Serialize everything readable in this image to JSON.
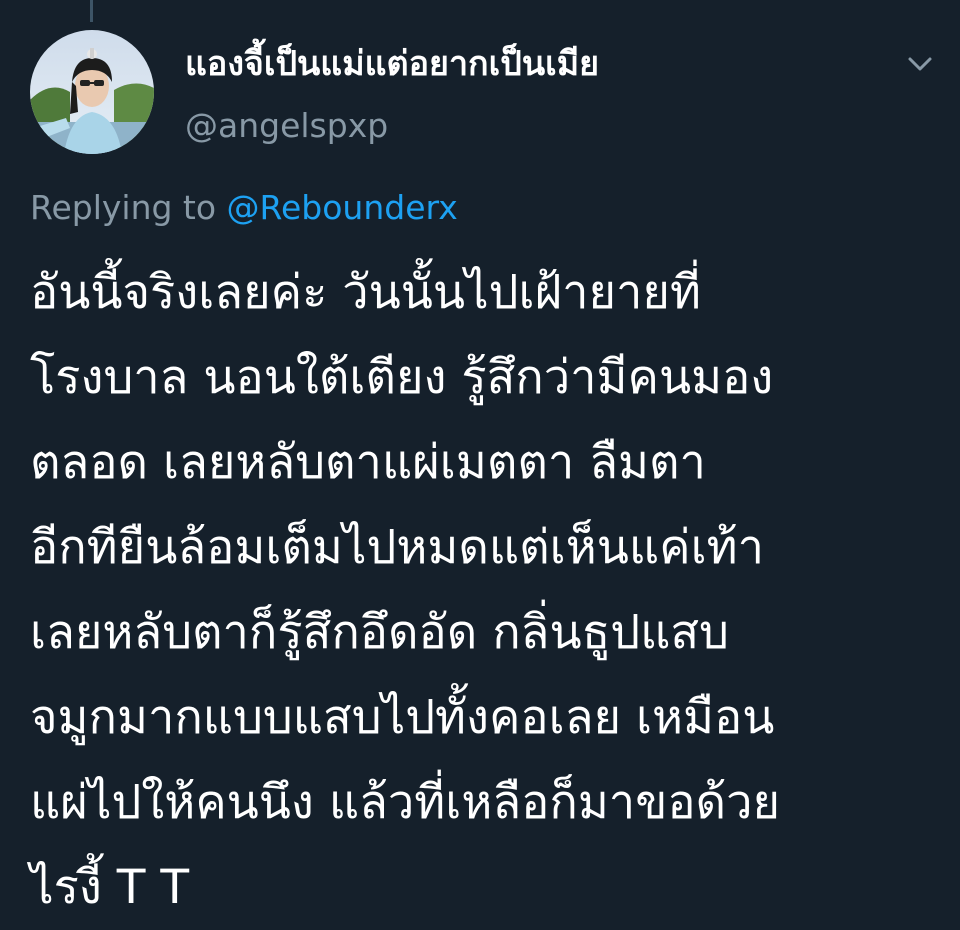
{
  "tweet": {
    "display_name": "แองจี้เป็นแม่แต่อยากเป็นเมีย",
    "handle": "@angelspxp",
    "reply_prefix": "Replying to",
    "reply_to": "@Rebounderx",
    "lines": [
      "อันนี้จริงเลยค่ะ วันนั้นไปเฝ้ายายที่",
      "โรงบาล นอนใต้เตียง รู้สึกว่ามีคนมอง",
      "ตลอด เลยหลับตาแผ่เมตตา ลืมตา",
      "อีกทียืนล้อมเต็มไปหมดแต่เห็นแค่เท้า",
      "เลยหลับตาก็รู้สึกอึดอัด กลิ่นธูปแสบ",
      "จมูกมากแบบแสบไปทั้งคอเลย เหมือน",
      "แผ่ไปให้คนนึง แล้วที่เหลือก็มาขอด้วย",
      "ไรงี้ T T"
    ]
  },
  "colors": {
    "background": "#15202b",
    "text": "#ffffff",
    "secondary_text": "#8899a6",
    "mention": "#1da1f2"
  },
  "icons": {
    "more": "chevron-down-icon",
    "avatar": "profile-photo"
  }
}
